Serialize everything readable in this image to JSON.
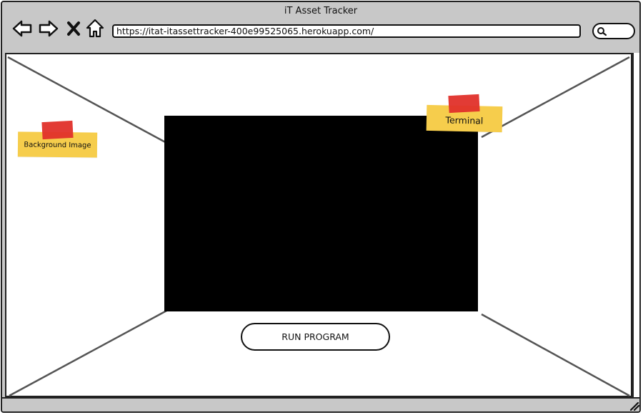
{
  "window": {
    "title": "iT Asset Tracker"
  },
  "toolbar": {
    "icons": [
      "back-arrow-icon",
      "forward-arrow-icon",
      "close-x-icon",
      "home-icon"
    ],
    "url": "https://itat-itassettracker-400e99525065.herokuapp.com/",
    "search_icon": "search-icon"
  },
  "content": {
    "notes": {
      "background": "Background Image",
      "terminal": "Terminal"
    },
    "run_button": "RUN PROGRAM"
  },
  "colors": {
    "chrome": "#c8c8c8",
    "sticky": "#f6cd4c",
    "tape": "#e0302a",
    "terminal": "#000000"
  }
}
